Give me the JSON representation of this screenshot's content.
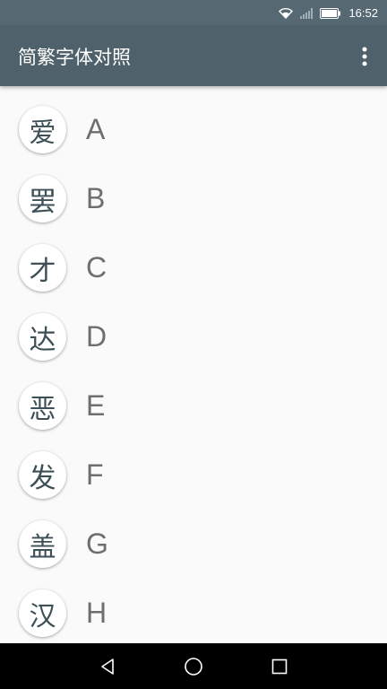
{
  "status_bar": {
    "time": "16:52",
    "icons": [
      "wifi-icon",
      "signal-icon",
      "battery-icon"
    ]
  },
  "app_bar": {
    "title": "简繁字体对照",
    "menu_icon": "more-vert-icon"
  },
  "list": {
    "items": [
      {
        "character": "爱",
        "letter": "A"
      },
      {
        "character": "罢",
        "letter": "B"
      },
      {
        "character": "才",
        "letter": "C"
      },
      {
        "character": "达",
        "letter": "D"
      },
      {
        "character": "恶",
        "letter": "E"
      },
      {
        "character": "发",
        "letter": "F"
      },
      {
        "character": "盖",
        "letter": "G"
      },
      {
        "character": "汉",
        "letter": "H"
      }
    ]
  },
  "nav_bar": {
    "icons": [
      "back-icon",
      "home-icon",
      "recents-icon"
    ]
  },
  "colors": {
    "status_bar": "#566973",
    "app_bar": "#4f626b",
    "background": "#fafafa",
    "avatar_text": "#3d4f57",
    "letter_text": "#6e6e6e"
  }
}
